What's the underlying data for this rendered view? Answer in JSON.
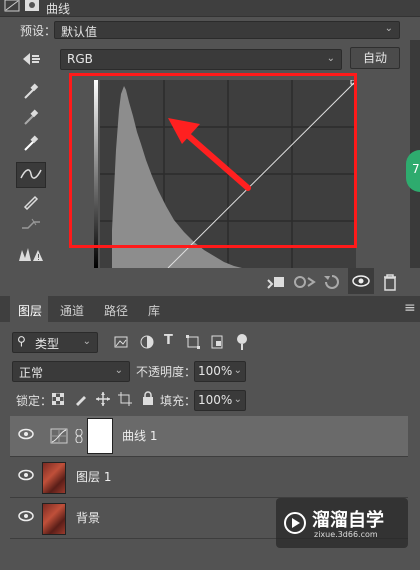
{
  "properties": {
    "title": "曲线",
    "preset_label": "预设：",
    "preset_value": "默认值",
    "channel_value": "RGB",
    "auto_label": "自动",
    "side_badge": "7"
  },
  "layers_panel": {
    "tabs": [
      "图层",
      "通道",
      "路径",
      "库"
    ],
    "filter_label": "类型",
    "blend_mode": "正常",
    "opacity_label": "不透明度：",
    "opacity_value": "100%",
    "lock_label": "锁定：",
    "fill_label": "填充：",
    "fill_value": "100%",
    "layers": [
      {
        "name": "曲线 1"
      },
      {
        "name": "图层 1"
      },
      {
        "name": "背景"
      }
    ]
  },
  "watermark": {
    "title": "溜溜自学",
    "url": "zixue.3d66.com"
  },
  "colors": {
    "highlight_red": "#ff1a1a",
    "panel_bg": "#535353",
    "dark_bg": "#3f3f3f",
    "selected_row": "#6a6a6a"
  }
}
